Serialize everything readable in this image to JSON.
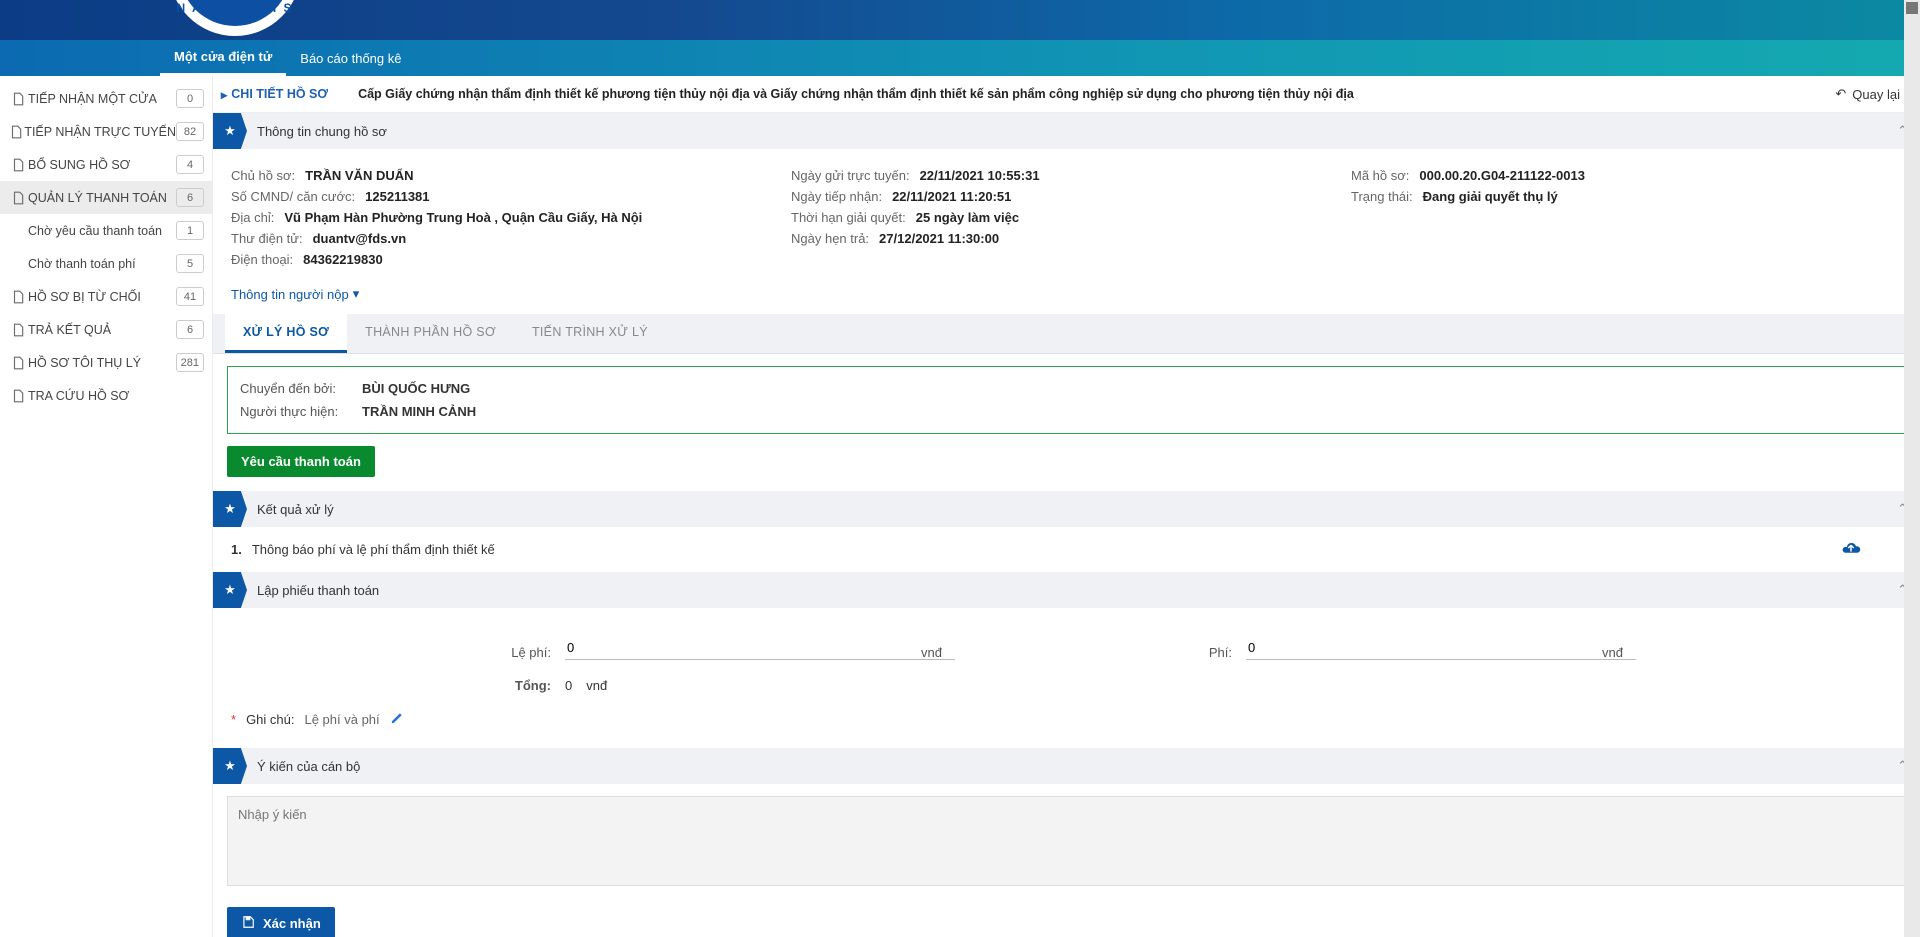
{
  "nav": {
    "item1": "Một cửa điện tử",
    "item2": "Báo cáo thống kê"
  },
  "sidebar": {
    "items": [
      {
        "label": "TIẾP NHẬN MỘT CỬA",
        "badge": "0"
      },
      {
        "label": "TIẾP NHẬN TRỰC TUYẾN",
        "badge": "82"
      },
      {
        "label": "BỔ SUNG HỒ SƠ",
        "badge": "4"
      },
      {
        "label": "QUẢN LÝ THANH TOÁN",
        "badge": "6"
      },
      {
        "label": "Chờ yêu cầu thanh toán",
        "badge": "1"
      },
      {
        "label": "Chờ thanh toán phí",
        "badge": "5"
      },
      {
        "label": "HỒ SƠ BỊ TỪ CHỐI",
        "badge": "41"
      },
      {
        "label": "TRẢ KẾT QUẢ",
        "badge": "6"
      },
      {
        "label": "HỒ SƠ TÔI THỤ LÝ",
        "badge": "281"
      },
      {
        "label": "TRA CỨU HỒ SƠ",
        "badge": ""
      }
    ]
  },
  "crumb": {
    "title": "CHI TIẾT HỒ SƠ",
    "desc": "Cấp Giấy chứng nhận thẩm định thiết kế phương tiện thủy nội địa và Giấy chứng nhận thẩm định thiết kế sản phẩm công nghiệp sử dụng cho phương tiện thủy nội địa",
    "back": "Quay lại"
  },
  "section_titles": {
    "info": "Thông tin chung hồ sơ",
    "result": "Kết quả xử lý",
    "fee": "Lập phiếu thanh toán",
    "opinion": "Ý kiến của cán bộ"
  },
  "info": {
    "owner_l": "Chủ hồ sơ:",
    "owner": "TRẦN VĂN DUẨN",
    "id_l": "Số CMND/ căn cước:",
    "id": "125211381",
    "addr_l": "Địa chỉ:",
    "addr": "Vũ Phạm Hàn Phường Trung Hoà , Quận Cầu Giấy, Hà Nội",
    "email_l": "Thư điện tử:",
    "email": "duantv@fds.vn",
    "phone_l": "Điện thoại:",
    "phone": "84362219830",
    "sent_l": "Ngày gửi trực tuyến:",
    "sent": "22/11/2021 10:55:31",
    "recv_l": "Ngày tiếp nhận:",
    "recv": "22/11/2021 11:20:51",
    "deadline_l": "Thời hạn giải quyết:",
    "deadline": "25 ngày làm việc",
    "due_l": "Ngày hẹn trả:",
    "due": "27/12/2021 11:30:00",
    "code_l": "Mã hồ sơ:",
    "code": "000.00.20.G04-211122-0013",
    "state_l": "Trạng thái:",
    "state": "Đang giải quyết thụ lý",
    "more": "Thông tin người nộp"
  },
  "tabs": {
    "t1": "XỬ LÝ HỒ SƠ",
    "t2": "THÀNH PHẦN HỒ SƠ",
    "t3": "TIẾN TRÌNH XỬ LÝ"
  },
  "forward": {
    "by_l": "Chuyển đến bởi:",
    "by": "BÙI QUỐC HƯNG",
    "exec_l": "Người thực hiện:",
    "exec": "TRẦN MINH CẢNH"
  },
  "actions": {
    "request_payment": "Yêu cầu thanh toán",
    "confirm": "Xác nhận"
  },
  "result": {
    "num": "1.",
    "text": "Thông báo phí và lệ phí thẩm định thiết kế"
  },
  "fee": {
    "label1": "Lệ phí:",
    "val1": "0",
    "unit": "vnđ",
    "label2": "Phí:",
    "val2": "0",
    "total_l": "Tổng:",
    "total_v": "0",
    "note_l": "Ghi chú:",
    "note_v": "Lệ phí và phí"
  },
  "opinion": {
    "placeholder": "Nhập ý kiến"
  }
}
